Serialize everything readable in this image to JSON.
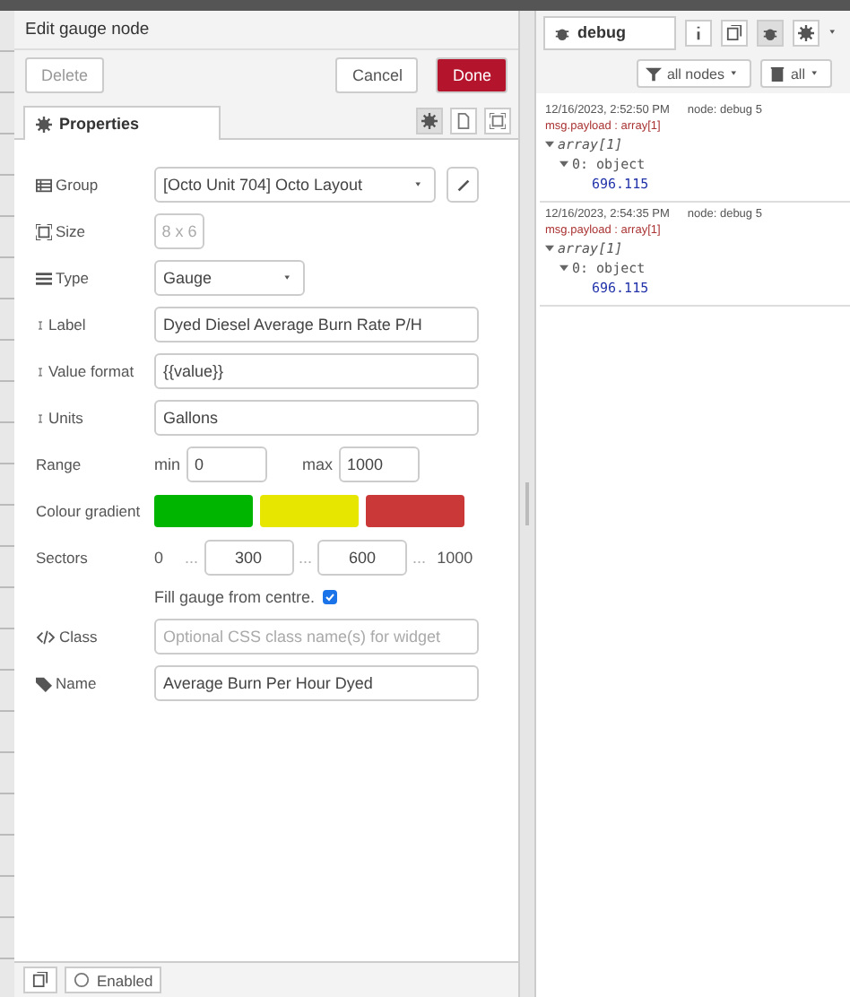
{
  "editor": {
    "title": "Edit gauge node",
    "buttons": {
      "delete": "Delete",
      "cancel": "Cancel",
      "done": "Done"
    },
    "tabs": [
      {
        "label": "Properties",
        "selected": true
      }
    ],
    "group": {
      "label": "Group",
      "value": "[Octo Unit 704] Octo Layout"
    },
    "size": {
      "label": "Size",
      "value": "8 x 6"
    },
    "type": {
      "label": "Type",
      "value": "Gauge"
    },
    "text_fields": [
      {
        "label": "Label",
        "value": "Dyed Diesel Average Burn Rate P/H"
      },
      {
        "label": "Value format",
        "value": "{{value}}"
      },
      {
        "label": "Units",
        "value": "Gallons"
      }
    ],
    "range": {
      "label": "Range",
      "min_label": "min",
      "min": "0",
      "max_label": "max",
      "max": "1000"
    },
    "colour_gradient": {
      "label": "Colour gradient",
      "swatches": [
        {
          "color": "#00b500"
        },
        {
          "color": "#e6e600"
        },
        {
          "color": "#ca3838"
        }
      ]
    },
    "sectors": {
      "label": "Sectors",
      "start": "0",
      "low": "300",
      "high": "600",
      "end": "1000",
      "separators": [
        "...",
        "...",
        "..."
      ]
    },
    "fill_from_centre": {
      "label": "Fill gauge from centre.",
      "checked": true
    },
    "class": {
      "label": "Class",
      "placeholder": "Optional CSS class name(s) for widget"
    },
    "name": {
      "label": "Name",
      "value": "Average Burn Per Hour Dyed"
    },
    "footer": {
      "enabled": "Enabled"
    }
  },
  "debug": {
    "tab": "debug",
    "filter": "all nodes",
    "clear": "all",
    "messages": [
      {
        "time": "12/16/2023, 2:52:50 PM",
        "node": "node: debug 5",
        "topic": "msg.payload : array[1]",
        "tree": [
          {
            "label": "array[1]",
            "expanded": true,
            "children": [
              {
                "label": "0: object",
                "expanded": true,
                "children": [
                  {
                    "value": "696.115"
                  }
                ]
              }
            ]
          }
        ]
      },
      {
        "time": "12/16/2023, 2:54:35 PM",
        "node": "node: debug 5",
        "topic": "msg.payload : array[1]",
        "tree": [
          {
            "label": "array[1]",
            "expanded": true,
            "children": [
              {
                "label": "0: object",
                "expanded": true,
                "children": [
                  {
                    "value": "696.115"
                  }
                ]
              }
            ]
          }
        ]
      }
    ]
  }
}
